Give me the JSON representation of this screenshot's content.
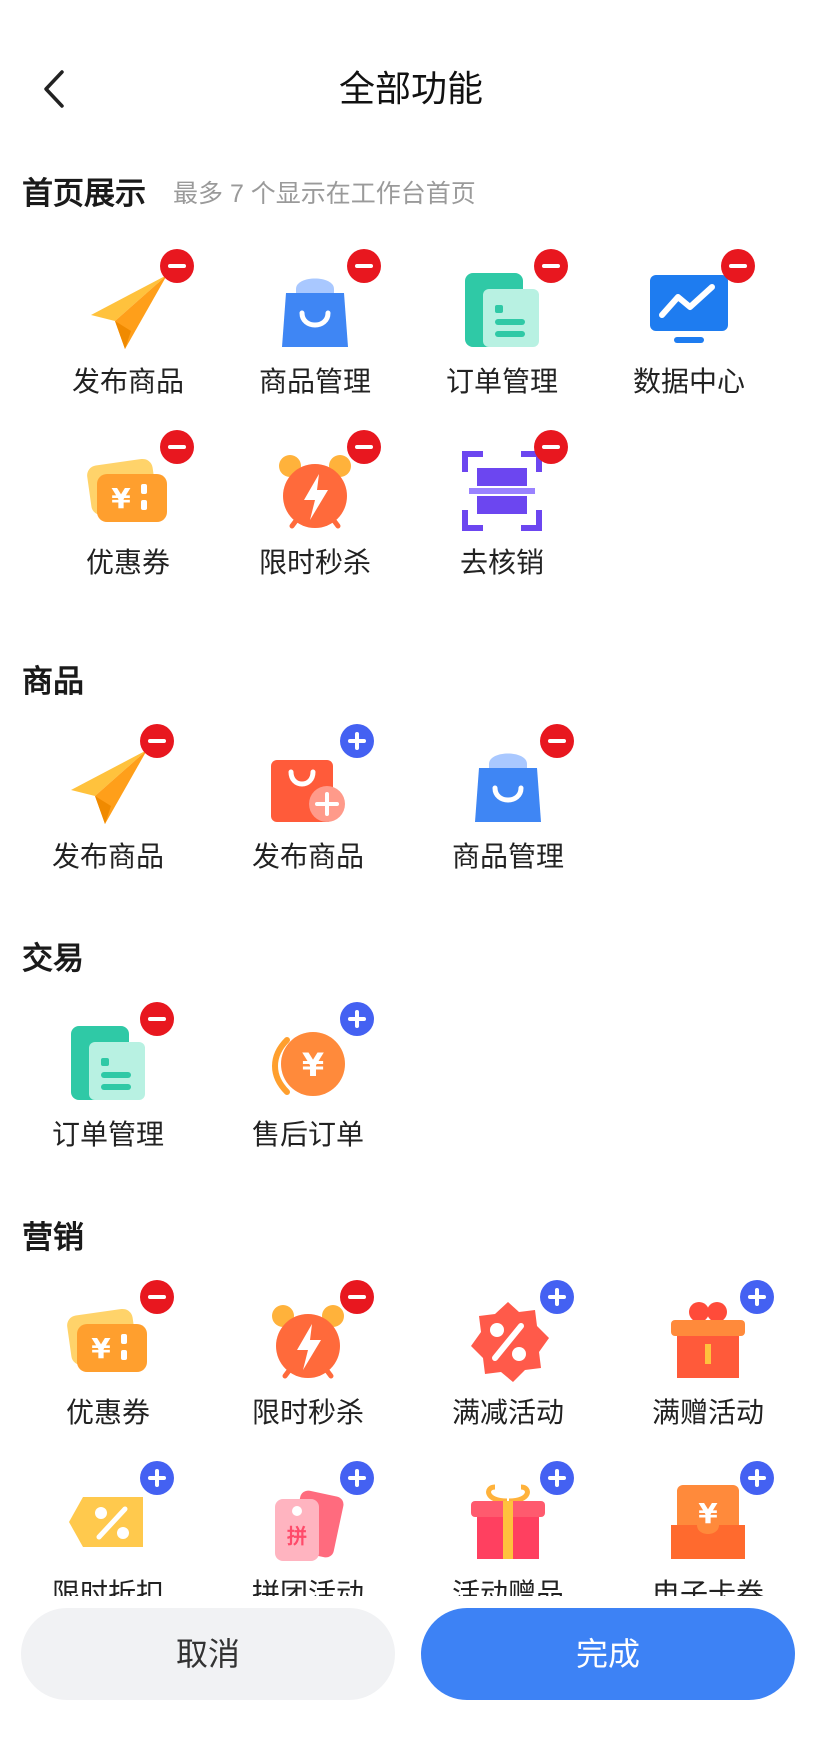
{
  "header": {
    "title": "全部功能",
    "back_icon": "chevron-left-icon"
  },
  "colors": {
    "accent": "#3d82f5",
    "remove": "#e8171f",
    "add": "#4461f2"
  },
  "sections": {
    "home": {
      "title": "首页展示",
      "subtitle": "最多 7 个显示在工作台首页",
      "items": [
        {
          "label": "发布商品",
          "icon": "paper-plane-icon",
          "badge": "remove"
        },
        {
          "label": "商品管理",
          "icon": "shopping-bag-icon",
          "badge": "remove"
        },
        {
          "label": "订单管理",
          "icon": "order-list-icon",
          "badge": "remove"
        },
        {
          "label": "数据中心",
          "icon": "data-monitor-icon",
          "badge": "remove"
        },
        {
          "label": "优惠券",
          "icon": "coupon-icon",
          "badge": "remove"
        },
        {
          "label": "限时秒杀",
          "icon": "alarm-clock-icon",
          "badge": "remove"
        },
        {
          "label": "去核销",
          "icon": "scan-icon",
          "badge": "remove"
        }
      ]
    },
    "goods": {
      "title": "商品",
      "items": [
        {
          "label": "发布商品",
          "icon": "paper-plane-icon",
          "badge": "remove"
        },
        {
          "label": "发布商品",
          "icon": "bag-add-icon",
          "badge": "add"
        },
        {
          "label": "商品管理",
          "icon": "shopping-bag-icon",
          "badge": "remove"
        }
      ]
    },
    "trade": {
      "title": "交易",
      "items": [
        {
          "label": "订单管理",
          "icon": "order-list-icon",
          "badge": "remove"
        },
        {
          "label": "售后订单",
          "icon": "refund-coin-icon",
          "badge": "add"
        }
      ]
    },
    "marketing": {
      "title": "营销",
      "items": [
        {
          "label": "优惠券",
          "icon": "coupon-icon",
          "badge": "remove"
        },
        {
          "label": "限时秒杀",
          "icon": "alarm-clock-icon",
          "badge": "remove"
        },
        {
          "label": "满减活动",
          "icon": "percent-badge-icon",
          "badge": "add"
        },
        {
          "label": "满赠活动",
          "icon": "gift-box-icon",
          "badge": "add"
        },
        {
          "label": "限时折扣",
          "icon": "discount-tag-icon",
          "badge": "add"
        },
        {
          "label": "拼团活动",
          "icon": "group-tag-icon",
          "badge": "add"
        },
        {
          "label": "活动赠品",
          "icon": "gift-icon",
          "badge": "add"
        },
        {
          "label": "电子卡券",
          "icon": "e-card-icon",
          "badge": "add"
        }
      ]
    }
  },
  "footer": {
    "cancel": "取消",
    "done": "完成"
  }
}
